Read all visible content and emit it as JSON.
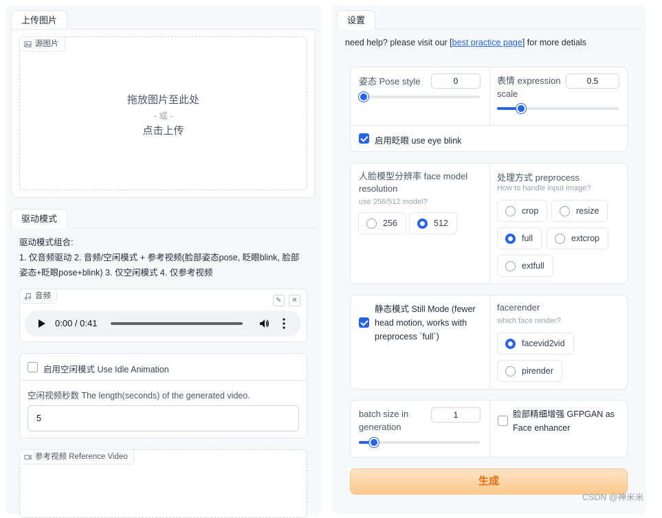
{
  "left": {
    "upload_tab": "上传图片",
    "source_image": {
      "chip": "源图片",
      "drop_text": "拖放图片至此处",
      "or_text": "- 或 -",
      "click_text": "点击上传"
    },
    "drive_tab": "驱动模式",
    "drive_desc_title": "驱动模式组合:",
    "drive_desc_line1": "1. 仅音频驱动 2. 音频/空闲模式 + 参考视频(脸部姿态pose, 眨眼blink, 脸部",
    "drive_desc_line2": "姿态+眨眼pose+blink) 3. 仅空闲模式 4. 仅参考视频",
    "audio": {
      "chip": "音频",
      "time": "0:00 / 0:41",
      "progress": 0
    },
    "idle": {
      "checkbox_label": "启用空闲模式 Use Idle Animation",
      "checked": false,
      "length_label": "空闲视频秒数 The length(seconds) of the generated video.",
      "length_value": "5"
    },
    "ref_video_chip": "参考视频 Reference Video"
  },
  "right": {
    "settings_tab": "设置",
    "help_prefix": "need help? please visit our [",
    "help_link": "best practice page",
    "help_suffix": "] for more detials",
    "pose_style": {
      "label": "姿态 Pose style",
      "value": "0",
      "fraction": 0
    },
    "expression_scale": {
      "label_line1": "表情 expression",
      "label_line2": "scale",
      "value": "0.5",
      "fraction": 0.2
    },
    "eye_blink": {
      "label": "启用眨眼 use eye blink",
      "checked": true
    },
    "face_model": {
      "label_line1": "人脸模型分辨率 face model",
      "label_line2": "resolution",
      "hint": "use 256/512 model?",
      "options": [
        "256",
        "512"
      ],
      "selected": "512"
    },
    "preprocess": {
      "label": "处理方式 preprocess",
      "hint": "How to handle input image?",
      "options": [
        "crop",
        "resize",
        "full",
        "extcrop",
        "extfull"
      ],
      "selected": "full"
    },
    "still_mode": {
      "line1": "静态模式 Still Mode (fewer",
      "line2": "head motion, works with",
      "line3": "preprocess `full`)",
      "checked": true
    },
    "facerender": {
      "label": "facerender",
      "hint": "which face render?",
      "options": [
        "facevid2vid",
        "pirender"
      ],
      "selected": "facevid2vid"
    },
    "batch_size": {
      "label_line1": "batch size in",
      "label_line2": "generation",
      "value": "1",
      "fraction": 0.1
    },
    "gfpgan": {
      "line1": "脸部精细增强 GFPGAN as",
      "line2": "Face enhancer",
      "checked": false
    },
    "generate_button": "生成"
  },
  "watermark": "CSDN @神米米"
}
